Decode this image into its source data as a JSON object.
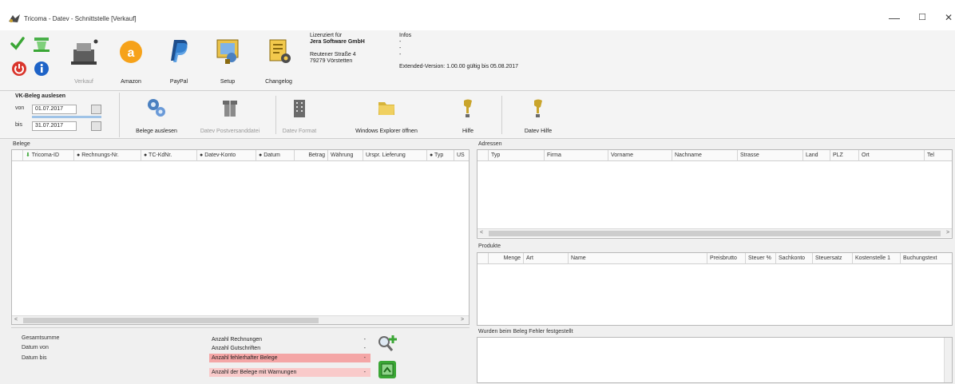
{
  "window": {
    "title": "Tricoma - Datev - Schnittstelle [Verkauf]",
    "controls": {
      "minimize": "—",
      "maximize": "☐",
      "close": "✕"
    }
  },
  "ribbon": {
    "buttons": [
      {
        "id": "verkauf",
        "label": "Verkauf",
        "icon": "scale-icon",
        "disabled": true
      },
      {
        "id": "amazon",
        "label": "Amazon",
        "icon": "amazon-icon",
        "disabled": false
      },
      {
        "id": "paypal",
        "label": "PayPal",
        "icon": "paypal-icon",
        "disabled": false
      },
      {
        "id": "setup",
        "label": "Setup",
        "icon": "setup-icon",
        "disabled": false
      },
      {
        "id": "changelog",
        "label": "Changelog",
        "icon": "changelog-icon",
        "disabled": false
      }
    ],
    "license": {
      "line1": "Lizenziert für",
      "company": "Jera Software GmbH",
      "street": "Reutener Straße 4",
      "city": "79279 Vörstetten"
    },
    "info": {
      "title": "Infos",
      "lines": [
        "-",
        "-",
        "-"
      ],
      "version": "Extended-Version: 1.00.00 gültig bis 05.08.2017"
    }
  },
  "vk_beleg": {
    "title": "VK-Beleg auslesen",
    "von_label": "von",
    "von_value": "01.07.2017",
    "bis_label": "bis",
    "bis_value": "31.07.2017"
  },
  "toolbar2": {
    "buttons": [
      {
        "label": "Belege auslesen",
        "icon": "gears-icon",
        "disabled": false
      },
      {
        "label": "Datev Postversanddatei",
        "icon": "package-icon",
        "disabled": true
      },
      {
        "label": "Datev Format",
        "icon": "building-icon",
        "disabled": true
      },
      {
        "label": "Windows Explorer öffnen",
        "icon": "folder-icon",
        "disabled": false
      },
      {
        "label": "Hilfe",
        "icon": "help-icon",
        "disabled": false
      },
      {
        "label": "Datev Hilfe",
        "icon": "help-icon",
        "disabled": false
      }
    ]
  },
  "belege": {
    "title": "Belege",
    "columns": [
      "Tricoma-ID",
      "Rechnungs-Nr.",
      "TC-KdNr.",
      "Datev-Konto",
      "Datum",
      "Betrag",
      "Währung",
      "Urspr. Lieferung",
      "Typ",
      "US"
    ],
    "scroll_left": "<",
    "scroll_right": ">"
  },
  "adressen": {
    "title": "Adressen",
    "columns": [
      "Typ",
      "Firma",
      "Vorname",
      "Nachname",
      "Strasse",
      "Land",
      "PLZ",
      "Ort",
      "Tel"
    ],
    "scroll_left": "<",
    "scroll_right": ">"
  },
  "produkte": {
    "title": "Produkte",
    "columns": [
      "Menge",
      "Art",
      "Name",
      "Preisbrutto",
      "Steuer %",
      "Sachkonto",
      "Steuersatz",
      "Kostenstelle 1",
      "Buchungstext"
    ]
  },
  "fehler": {
    "title": "Wurden beim Beleg Fehler festgestellt"
  },
  "summary": {
    "left": [
      "Gesamtsumme",
      "Datum von",
      "Datum bis"
    ],
    "rows": [
      {
        "label": "Anzahl Rechnungen",
        "value": "-"
      },
      {
        "label": "Anzahl Gutschriften",
        "value": "-"
      },
      {
        "label": "Anzahl fehlerhafter Belege",
        "value": "-"
      },
      {
        "label": "Anzahl der Belege mit Warnungen",
        "value": "-"
      }
    ]
  },
  "colors": {
    "accent_green": "#3aa635",
    "red": "#d9342b",
    "blue": "#1e63c7",
    "error_row": "#f4a6a6",
    "warning_row": "#f9caca"
  }
}
